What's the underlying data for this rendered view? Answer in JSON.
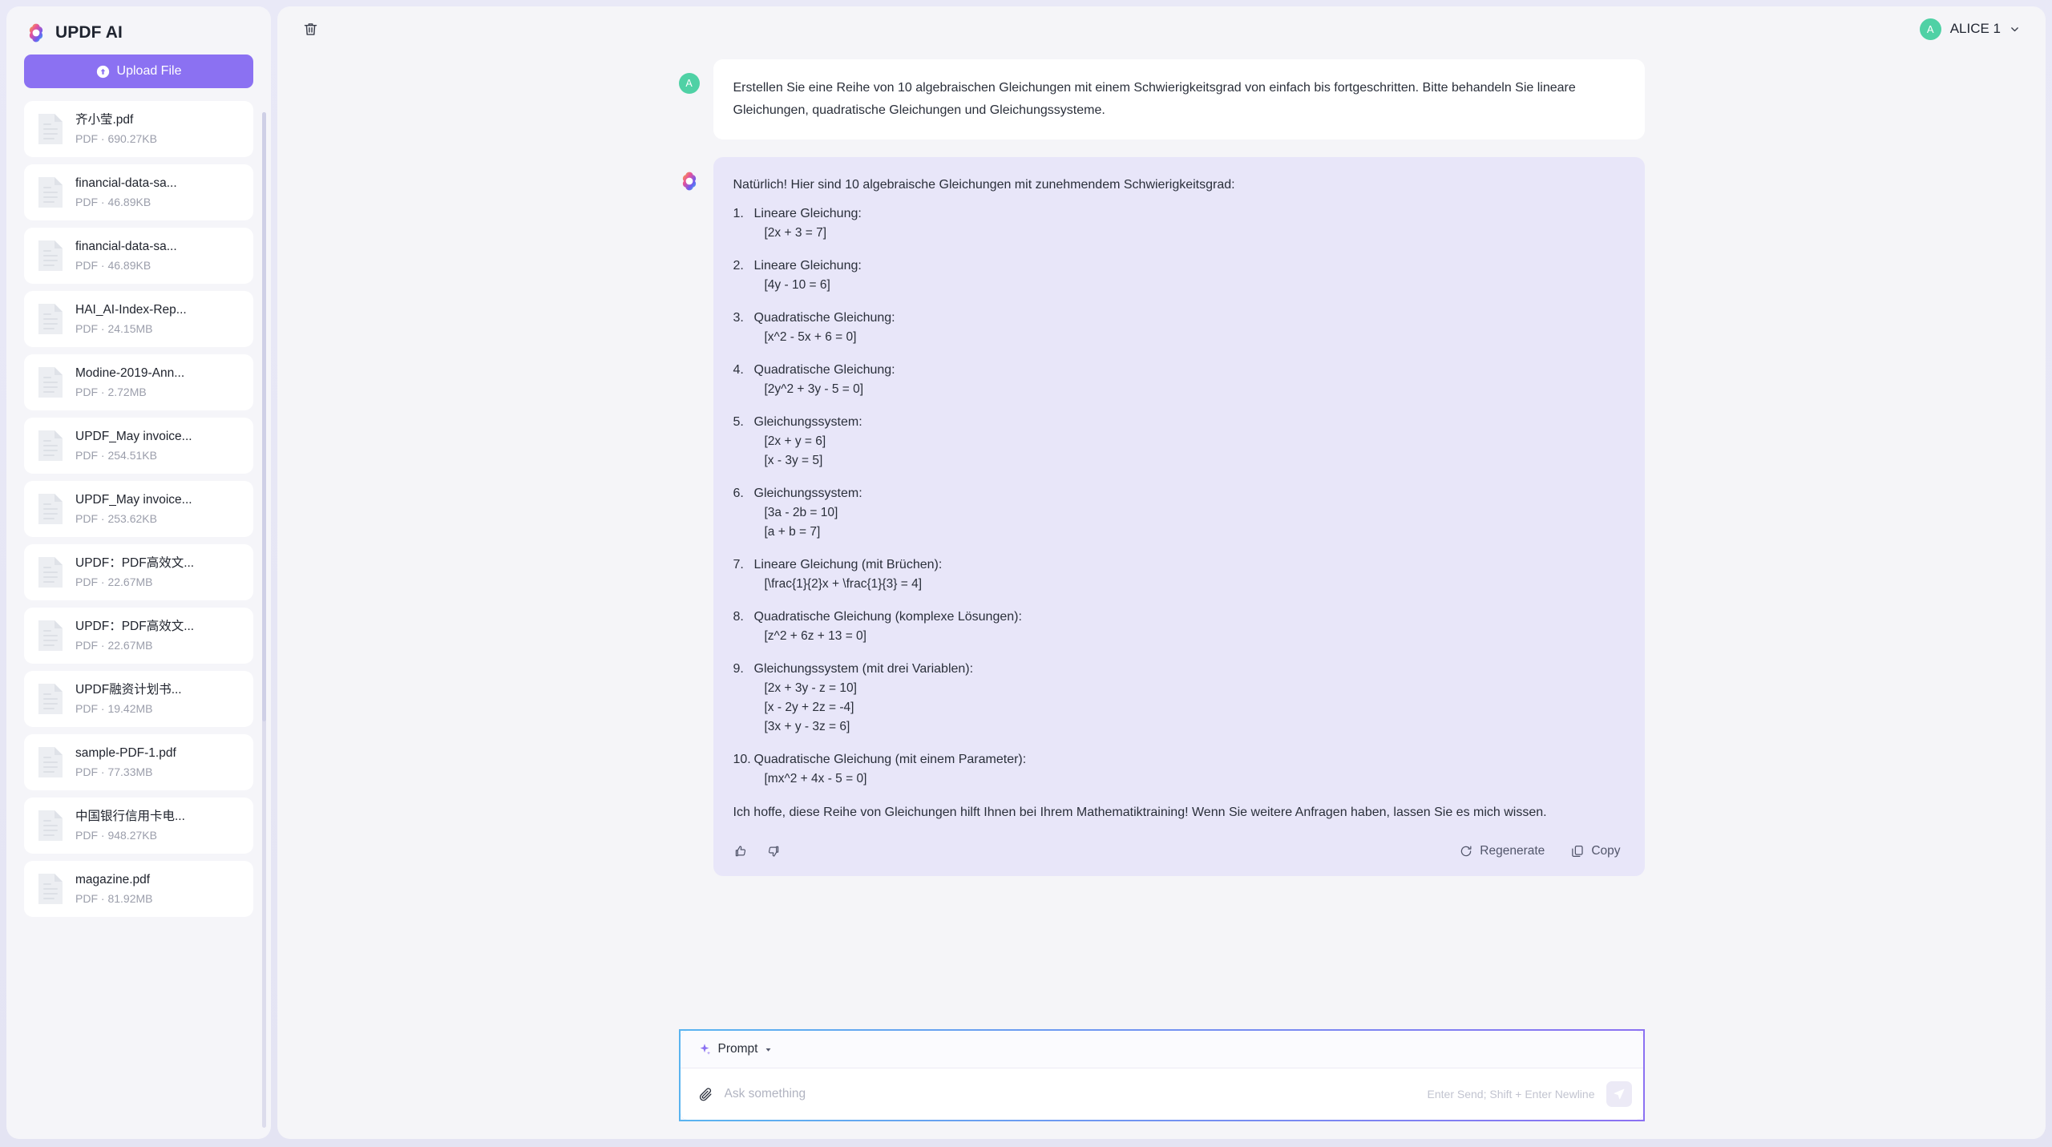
{
  "app": {
    "brand_title": "UPDF AI",
    "logo_icon": "updf-flower-logo",
    "accent_color": "#8b71f2",
    "user_bubble_bg": "#ffffff",
    "ai_bubble_bg": "#e8e6f9"
  },
  "sidebar": {
    "upload_label": "Upload File",
    "upload_icon": "upload-arrow-icon",
    "files": [
      {
        "name": "齐小莹.pdf",
        "meta": "PDF · 690.27KB"
      },
      {
        "name": "financial-data-sa...",
        "meta": "PDF · 46.89KB"
      },
      {
        "name": "financial-data-sa...",
        "meta": "PDF · 46.89KB"
      },
      {
        "name": "HAI_AI-Index-Rep...",
        "meta": "PDF · 24.15MB"
      },
      {
        "name": "Modine-2019-Ann...",
        "meta": "PDF · 2.72MB"
      },
      {
        "name": "UPDF_May invoice...",
        "meta": "PDF · 254.51KB"
      },
      {
        "name": "UPDF_May invoice...",
        "meta": "PDF · 253.62KB"
      },
      {
        "name": "UPDF：PDF高效文...",
        "meta": "PDF · 22.67MB"
      },
      {
        "name": "UPDF：PDF高效文...",
        "meta": "PDF · 22.67MB"
      },
      {
        "name": "UPDF融资计划书...",
        "meta": "PDF · 19.42MB"
      },
      {
        "name": "sample-PDF-1.pdf",
        "meta": "PDF · 77.33MB"
      },
      {
        "name": "中国银行信用卡电...",
        "meta": "PDF · 948.27KB"
      },
      {
        "name": "magazine.pdf",
        "meta": "PDF · 81.92MB"
      }
    ]
  },
  "topbar": {
    "delete_icon": "trash-icon",
    "user_initial": "A",
    "user_name": "ALICE 1",
    "chevron_icon": "chevron-down-icon"
  },
  "conversation": {
    "user_message": {
      "avatar_initial": "A",
      "text": "Erstellen Sie eine Reihe von 10 algebraischen Gleichungen mit einem Schwierigkeitsgrad von einfach bis fortgeschritten. Bitte behandeln Sie lineare Gleichungen, quadratische Gleichungen und Gleichungssysteme."
    },
    "ai_message": {
      "intro": "Natürlich! Hier sind 10 algebraische Gleichungen mit zunehmendem Schwierigkeitsgrad:",
      "items": [
        {
          "num": "1.",
          "title": "Lineare Gleichung:",
          "lines": [
            "[2x + 3 = 7]"
          ]
        },
        {
          "num": "2.",
          "title": "Lineare Gleichung:",
          "lines": [
            "[4y - 10 = 6]"
          ]
        },
        {
          "num": "3.",
          "title": "Quadratische Gleichung:",
          "lines": [
            "[x^2 - 5x + 6 = 0]"
          ]
        },
        {
          "num": "4.",
          "title": "Quadratische Gleichung:",
          "lines": [
            "[2y^2 + 3y - 5 = 0]"
          ]
        },
        {
          "num": "5.",
          "title": "Gleichungssystem:",
          "lines": [
            "[2x + y = 6]",
            "[x - 3y = 5]"
          ]
        },
        {
          "num": "6.",
          "title": "Gleichungssystem:",
          "lines": [
            "[3a - 2b = 10]",
            "[a + b = 7]"
          ]
        },
        {
          "num": "7.",
          "title": "Lineare Gleichung (mit Brüchen):",
          "lines": [
            "[\\frac{1}{2}x + \\frac{1}{3} = 4]"
          ]
        },
        {
          "num": "8.",
          "title": "Quadratische Gleichung (komplexe Lösungen):",
          "lines": [
            "[z^2 + 6z + 13 = 0]"
          ]
        },
        {
          "num": "9.",
          "title": "Gleichungssystem (mit drei Variablen):",
          "lines": [
            "[2x + 3y - z = 10]",
            "[x - 2y + 2z = -4]",
            "[3x + y - 3z = 6]"
          ]
        },
        {
          "num": "10.",
          "title": "Quadratische Gleichung (mit einem Parameter):",
          "lines": [
            "[mx^2 + 4x - 5 = 0]"
          ]
        }
      ],
      "outro": "Ich hoffe, diese Reihe von Gleichungen hilft Ihnen bei Ihrem Mathematiktraining! Wenn Sie weitere Anfragen haben, lassen Sie es mich wissen.",
      "actions": {
        "like_icon": "thumbs-up-icon",
        "dislike_icon": "thumbs-down-icon",
        "regenerate_label": "Regenerate",
        "regenerate_icon": "refresh-icon",
        "copy_label": "Copy",
        "copy_icon": "copy-icon"
      }
    }
  },
  "composer": {
    "prompt_label": "Prompt",
    "prompt_icon": "sparkle-icon",
    "caret_icon": "caret-down-icon",
    "attach_icon": "paperclip-icon",
    "input_value": "",
    "input_placeholder": "Ask something",
    "hint": "Enter Send; Shift + Enter Newline",
    "send_icon": "send-plane-icon"
  }
}
